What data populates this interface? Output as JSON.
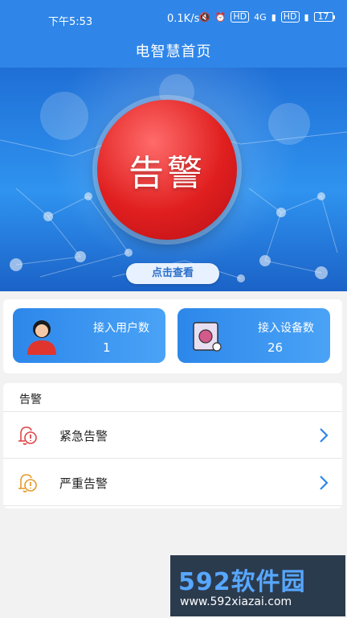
{
  "status_bar": {
    "time": "下午5:53",
    "network_speed": "0.1K/s",
    "battery": "17",
    "network_label": "4G",
    "hd_label": "HD"
  },
  "header": {
    "title": "电智慧首页"
  },
  "banner": {
    "alarm_text": "告警",
    "check_button": "点击查看"
  },
  "stats": {
    "users": {
      "label": "接入用户数",
      "value": "1"
    },
    "devices": {
      "label": "接入设备数",
      "value": "26"
    }
  },
  "alarm_section": {
    "title": "告警",
    "items": [
      {
        "label": "紧急告警",
        "color": "#e04545"
      },
      {
        "label": "严重告警",
        "color": "#e69a2b"
      }
    ]
  },
  "watermark": {
    "brand": "592软件园",
    "url": "www.592xiazai.com"
  },
  "colors": {
    "primary": "#2f86e8",
    "alarm_red": "#e01f1f",
    "background": "#f2f2f2"
  }
}
